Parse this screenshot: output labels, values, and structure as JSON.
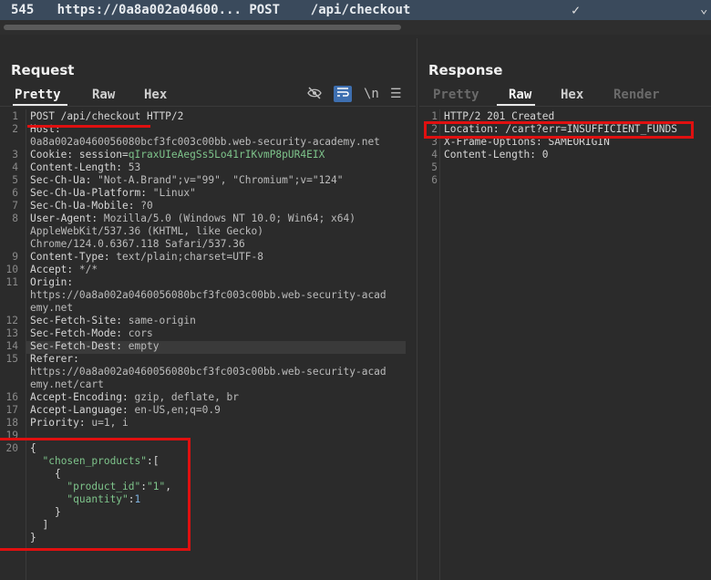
{
  "history_row": {
    "number": "545",
    "url": "https://0a8a002a04600...",
    "method": "POST",
    "path": "/api/checkout",
    "status_icon": "check-icon"
  },
  "request": {
    "title": "Request",
    "tabs": [
      "Pretty",
      "Raw",
      "Hex"
    ],
    "active_tab": "Pretty",
    "controls": {
      "hide_icon": "eye-slash-icon",
      "wrap_icon": "wrap-icon",
      "newline": "\\n",
      "menu_icon": "menu-icon"
    },
    "lines": [
      {
        "n": "1",
        "key": "POST /api/checkout HTTP/2",
        "val": ""
      },
      {
        "n": "2",
        "key": "Host:",
        "val": ""
      },
      {
        "n": "",
        "key": "",
        "val": "0a8a002a0460056080bcf3fc003c00bb.web-security-academy.net"
      },
      {
        "n": "3",
        "key": "Cookie: session=",
        "val": "qIraxUIeAegSs5Lo41rIKvmP8pUR4EIX"
      },
      {
        "n": "4",
        "key": "Content-Length: ",
        "val": "53"
      },
      {
        "n": "5",
        "key": "Sec-Ch-Ua: ",
        "val": "\"Not-A.Brand\";v=\"99\", \"Chromium\";v=\"124\""
      },
      {
        "n": "6",
        "key": "Sec-Ch-Ua-Platform: ",
        "val": "\"Linux\""
      },
      {
        "n": "7",
        "key": "Sec-Ch-Ua-Mobile: ",
        "val": "?0"
      },
      {
        "n": "8",
        "key": "User-Agent: ",
        "val": "Mozilla/5.0 (Windows NT 10.0; Win64; x64)"
      },
      {
        "n": "",
        "key": "",
        "val": "AppleWebKit/537.36 (KHTML, like Gecko)"
      },
      {
        "n": "",
        "key": "",
        "val": "Chrome/124.0.6367.118 Safari/537.36"
      },
      {
        "n": "9",
        "key": "Content-Type: ",
        "val": "text/plain;charset=UTF-8"
      },
      {
        "n": "10",
        "key": "Accept: ",
        "val": "*/*"
      },
      {
        "n": "11",
        "key": "Origin:",
        "val": ""
      },
      {
        "n": "",
        "key": "",
        "val": "https://0a8a002a0460056080bcf3fc003c00bb.web-security-acad"
      },
      {
        "n": "",
        "key": "",
        "val": "emy.net"
      },
      {
        "n": "12",
        "key": "Sec-Fetch-Site: ",
        "val": "same-origin"
      },
      {
        "n": "13",
        "key": "Sec-Fetch-Mode: ",
        "val": "cors"
      },
      {
        "n": "14",
        "key": "Sec-Fetch-Dest: ",
        "val": "empty"
      },
      {
        "n": "15",
        "key": "Referer:",
        "val": ""
      },
      {
        "n": "",
        "key": "",
        "val": "https://0a8a002a0460056080bcf3fc003c00bb.web-security-acad"
      },
      {
        "n": "",
        "key": "",
        "val": "emy.net/cart"
      },
      {
        "n": "16",
        "key": "Accept-Encoding: ",
        "val": "gzip, deflate, br"
      },
      {
        "n": "17",
        "key": "Accept-Language: ",
        "val": "en-US,en;q=0.9"
      },
      {
        "n": "18",
        "key": "Priority: ",
        "val": "u=1, i"
      },
      {
        "n": "19",
        "key": "",
        "val": ""
      },
      {
        "n": "20",
        "key": "{",
        "val": ""
      },
      {
        "n": "",
        "key": "  ",
        "val": "",
        "json_key": "\"chosen_products\"",
        "tail": ":["
      },
      {
        "n": "",
        "key": "    {",
        "val": ""
      },
      {
        "n": "",
        "key": "      ",
        "val": "",
        "json_key": "\"product_id\"",
        "tail": ":",
        "json_str": "\"1\"",
        "tail2": ","
      },
      {
        "n": "",
        "key": "      ",
        "val": "",
        "json_key": "\"quantity\"",
        "tail": ":",
        "json_num": "1"
      },
      {
        "n": "",
        "key": "    }",
        "val": ""
      },
      {
        "n": "",
        "key": "  ]",
        "val": ""
      },
      {
        "n": "",
        "key": "}",
        "val": ""
      }
    ]
  },
  "response": {
    "title": "Response",
    "tabs": [
      "Pretty",
      "Raw",
      "Hex",
      "Render"
    ],
    "active_tab": "Raw",
    "lines": [
      {
        "n": "1",
        "text": "HTTP/2 201 Created"
      },
      {
        "n": "2",
        "text": "Location: /cart?err=INSUFFICIENT_FUNDS"
      },
      {
        "n": "3",
        "text": "X-Frame-Options: SAMEORIGIN"
      },
      {
        "n": "4",
        "text": "Content-Length: 0"
      },
      {
        "n": "5",
        "text": ""
      },
      {
        "n": "6",
        "text": ""
      }
    ]
  },
  "colors": {
    "highlight": "#e01010",
    "tab_bar": "#3a4a5c",
    "cookie_value": "#7ec48b"
  }
}
